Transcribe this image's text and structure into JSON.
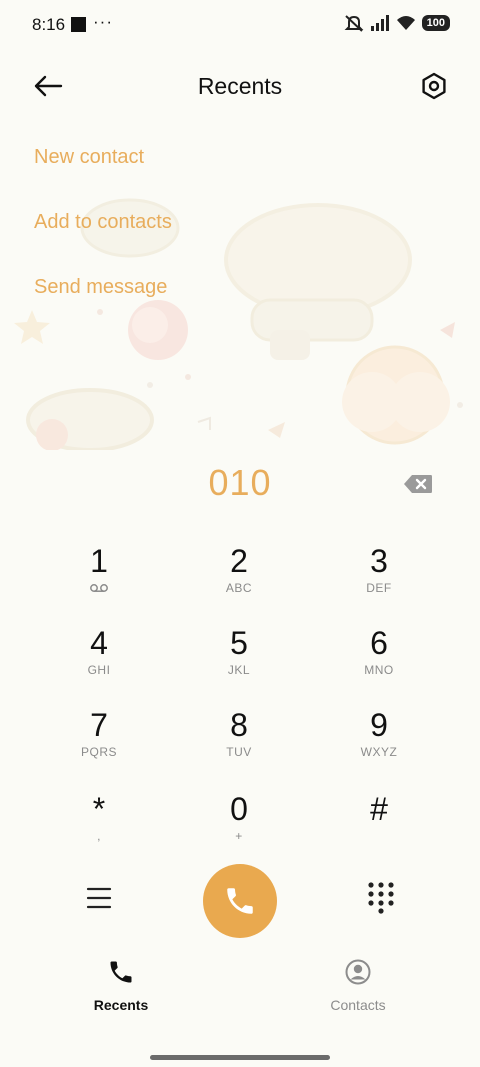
{
  "status_bar": {
    "time": "8:16",
    "dots": "···",
    "battery": "100"
  },
  "header": {
    "title": "Recents"
  },
  "actions": {
    "new_contact": "New contact",
    "add_to_contacts": "Add to contacts",
    "send_message": "Send message"
  },
  "dialer": {
    "number": "010"
  },
  "keypad": [
    {
      "digit": "1",
      "letters": ""
    },
    {
      "digit": "2",
      "letters": "ABC"
    },
    {
      "digit": "3",
      "letters": "DEF"
    },
    {
      "digit": "4",
      "letters": "GHI"
    },
    {
      "digit": "5",
      "letters": "JKL"
    },
    {
      "digit": "6",
      "letters": "MNO"
    },
    {
      "digit": "7",
      "letters": "PQRS"
    },
    {
      "digit": "8",
      "letters": "TUV"
    },
    {
      "digit": "9",
      "letters": "WXYZ"
    },
    {
      "digit": "*",
      "letters": ","
    },
    {
      "digit": "0",
      "letters": "+"
    },
    {
      "digit": "#",
      "letters": ""
    }
  ],
  "bottom_nav": {
    "recents": "Recents",
    "contacts": "Contacts"
  },
  "colors": {
    "accent": "#e9a94f",
    "background": "#fbfbf6"
  }
}
